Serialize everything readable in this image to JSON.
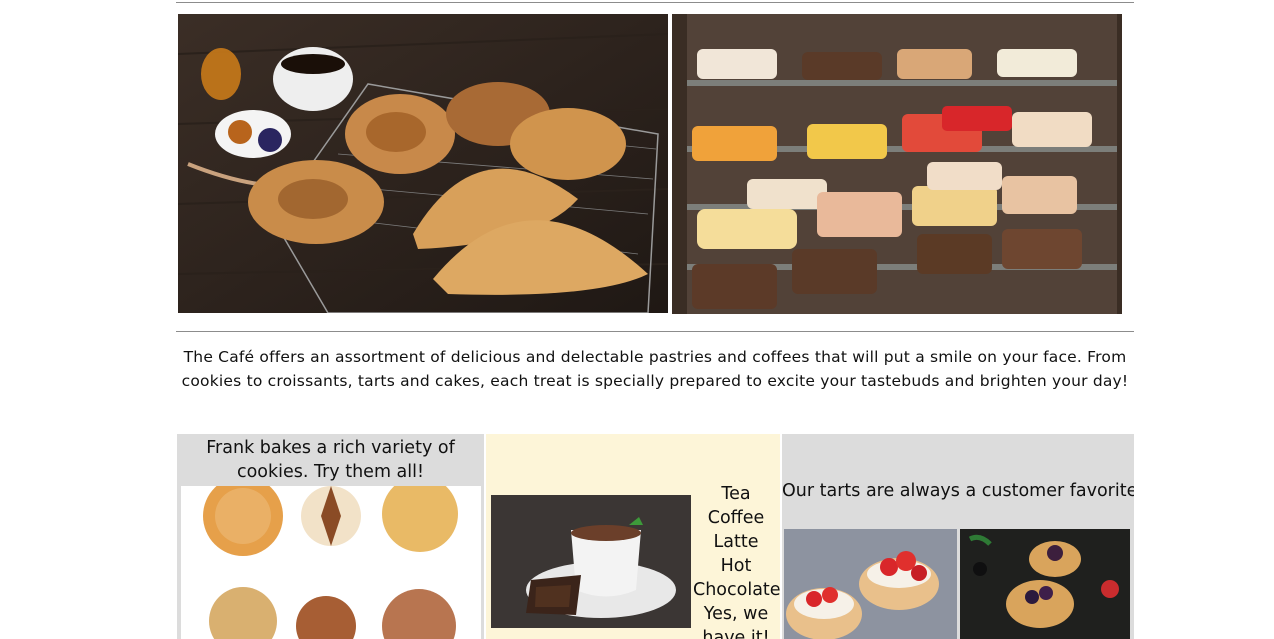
{
  "intro": {
    "text": "The Café offers an assortment of delicious and delectable pastries and coffees that will put a smile on your face. From cookies to croissants, tarts and cakes, each treat is specially prepared to excite your tastebuds and brighten your day!"
  },
  "features": {
    "cookies": {
      "caption": "Frank bakes a rich variety of cookies. Try them all!"
    },
    "drinks": {
      "items": [
        "Tea",
        "Coffee",
        "Latte",
        "Hot Chocolate",
        "Yes, we have it!"
      ]
    },
    "tarts": {
      "caption": "Our tarts are always a customer favorite!"
    }
  },
  "colors": {
    "drinks_bg": "#fdf5d8",
    "card_bg": "#dcdcdc",
    "rule": "#8c8c8c"
  }
}
